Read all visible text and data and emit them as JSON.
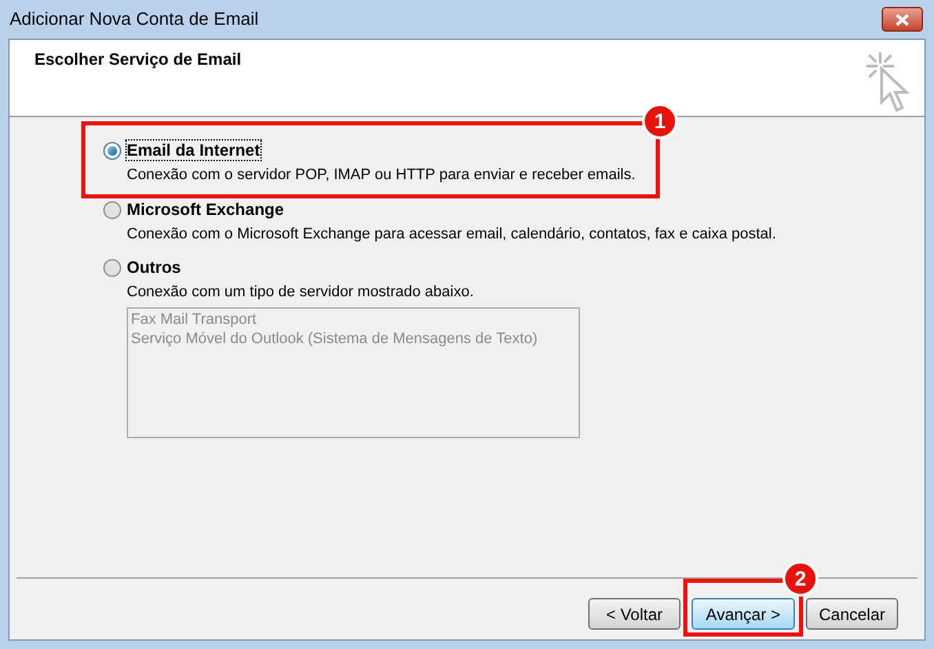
{
  "window": {
    "title": "Adicionar Nova Conta de Email"
  },
  "header": {
    "title": "Escolher Serviço de Email"
  },
  "options": [
    {
      "label": "Email da Internet",
      "description": "Conexão com o servidor POP, IMAP ou HTTP para enviar e receber emails.",
      "selected": true,
      "annotation": "1"
    },
    {
      "label": "Microsoft Exchange",
      "description": "Conexão com o Microsoft Exchange para acessar email, calendário, contatos, fax e caixa postal.",
      "selected": false
    },
    {
      "label": "Outros",
      "description": "Conexão com um tipo de servidor mostrado abaixo.",
      "selected": false,
      "list": {
        "disabled": true,
        "items": [
          "Fax Mail Transport",
          "Serviço Móvel do Outlook (Sistema de Mensagens de Texto)"
        ]
      }
    }
  ],
  "buttons": [
    {
      "label": "< Voltar",
      "default": false
    },
    {
      "label": "Avançar >",
      "default": true,
      "annotation": "2"
    },
    {
      "label": "Cancelar",
      "default": false
    }
  ]
}
